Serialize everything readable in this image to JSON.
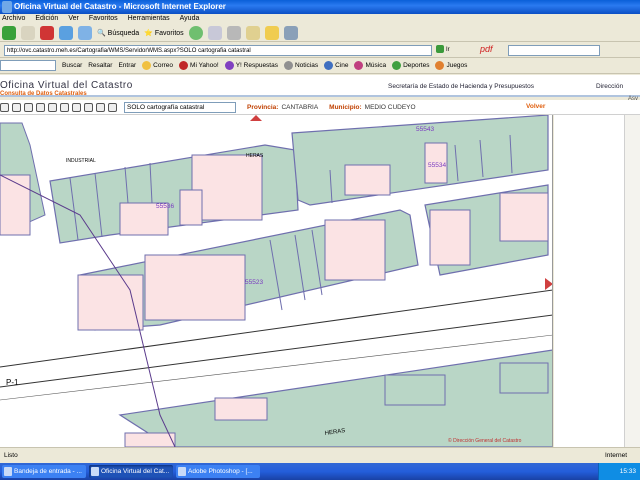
{
  "window": {
    "title": "Oficina Virtual del Catastro - Microsoft Internet Explorer"
  },
  "menu": [
    "Archivo",
    "Edición",
    "Ver",
    "Favoritos",
    "Herramientas",
    "Ayuda"
  ],
  "toolbar": {
    "search_label": "Búsqueda",
    "favorites_label": "Favoritos"
  },
  "address": {
    "url": "http://ovc.catastro.meh.es/Cartografia/WMS/ServidorWMS.aspx?SOLO cartografia catastral",
    "go_label": "Ir"
  },
  "pdf_label": "pdf",
  "links": {
    "search_label": "Buscar",
    "highlight_label": "Resaltar",
    "entrar_label": "Entrar",
    "items": [
      "Correo",
      "Mi Yahoo!",
      "Y! Respuestas",
      "Noticias",
      "Cine",
      "Música",
      "Deportes",
      "Juegos"
    ]
  },
  "banner": {
    "title": "Oficina Virtual del Catastro",
    "subtitle": "Consulta de Datos Catastrales",
    "ministry_link": "Secretaría de Estado de Hacienda y Presupuestos",
    "direction_link": "Dirección"
  },
  "maptools": {
    "layer_select": "SOLO cartografía catastral",
    "province_label": "Provincia:",
    "province_value": "CANTABRIA",
    "municipality_label": "Municipio:",
    "municipality_value": "MEDIO CUDEYO",
    "back_label": "Volver"
  },
  "asy": "Asy",
  "map": {
    "labels": {
      "industrial": "INDUSTRIAL",
      "heras_top": "HERAS",
      "p1": "P-1",
      "heras_road": "HERAS",
      "copyright": "© Dirección General del Catastro"
    },
    "blocks": [
      "55543",
      "55534",
      "55536",
      "55523"
    ],
    "colors": {
      "parcel": "#fbe3e4",
      "block": "#b9d6c6",
      "outline": "#6f6fae",
      "road": "#ffffff",
      "street_line": "#5b3b8c"
    }
  },
  "status": {
    "text": "Listo",
    "zone": "Internet"
  },
  "taskbar": {
    "items": [
      "Bandeja de entrada - ...",
      "Oficina Virtual del Cat...",
      "Adobe Photoshop - [..."
    ],
    "active": 1,
    "time": "15:33"
  }
}
